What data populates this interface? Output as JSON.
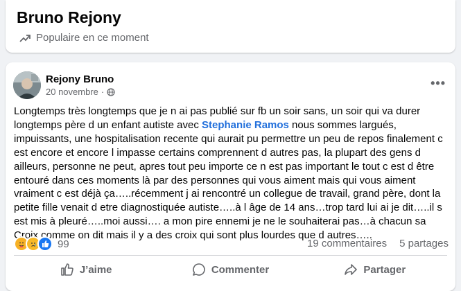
{
  "page": {
    "title": "Bruno Rejony",
    "trend_label": "Populaire en ce moment"
  },
  "post": {
    "author": "Rejony Bruno",
    "date": "20 novembre",
    "separator": "·",
    "more": "•••",
    "text_before_mention": "Longtemps très longtemps que je n ai pas publié sur fb un soir sans, un soir qui va durer longtemps père d un enfant autiste avec ",
    "mention": "Stephanie Ramos",
    "text_after_mention": " nous sommes largués, impuissants, une hospitalisation recente qui aurait pu permettre un peu de repos finalement c est encore et encore l impasse certains comprennent d autres pas, la plupart des gens d ailleurs, personne ne peut, apres tout peu importe ce n est pas important le tout c est d être entouré dans ces moments là par des personnes qui vous aiment mais qui vous aiment vraiment c est déjà ça…..récemment j ai rencontré un collegue de travail, grand père, dont la petite fille venait d etre diagnostiquée autiste…..à l âge de 14 ans…trop tard lui ai je dit…..il s est mis à pleuré…..moi aussi…. a mon pire ennemi je ne le souhaiterai pas…à chacun sa Croix comme on dit mais il y a des croix qui sont plus lourdes que d autres…..",
    "reactions_count": "99",
    "comments": "19 commentaires",
    "shares": "5 partages",
    "actions": {
      "like": "J’aime",
      "comment": "Commenter",
      "share": "Partager"
    },
    "icons": [
      "trending-icon",
      "globe-icon",
      "care-reaction-icon",
      "sad-reaction-icon",
      "like-reaction-icon",
      "thumbs-up-icon",
      "comment-icon",
      "share-icon"
    ]
  }
}
